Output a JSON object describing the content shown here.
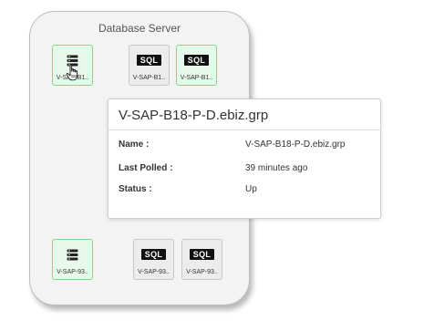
{
  "group": {
    "title": "Database Server"
  },
  "nodes": [
    {
      "label": "V-SAP-B1..",
      "kind": "server",
      "status": "up"
    },
    {
      "label": "V-SAP-B1..",
      "kind": "sql",
      "badge": "SQL",
      "status": "neutral"
    },
    {
      "label": "V-SAP-B1..",
      "kind": "sql",
      "badge": "SQL",
      "status": "up"
    },
    {
      "label": "V-SAP-93..",
      "kind": "server",
      "status": "up"
    },
    {
      "label": "V-SAP-93..",
      "kind": "sql",
      "badge": "SQL",
      "status": "neutral"
    },
    {
      "label": "V-SAP-93..",
      "kind": "sql",
      "badge": "SQL",
      "status": "neutral"
    }
  ],
  "tooltip": {
    "title": "V-SAP-B18-P-D.ebiz.grp",
    "name_key": "Name :",
    "name_value": "V-SAP-B18-P-D.ebiz.grp",
    "polled_key": "Last Polled :",
    "polled_value": "39 minutes ago",
    "status_key": "Status :",
    "status_value": "Up"
  },
  "colors": {
    "status_up_border": "#7fd98a",
    "status_up_fill": "#e8f8ea",
    "neutral_fill": "#ececec"
  }
}
